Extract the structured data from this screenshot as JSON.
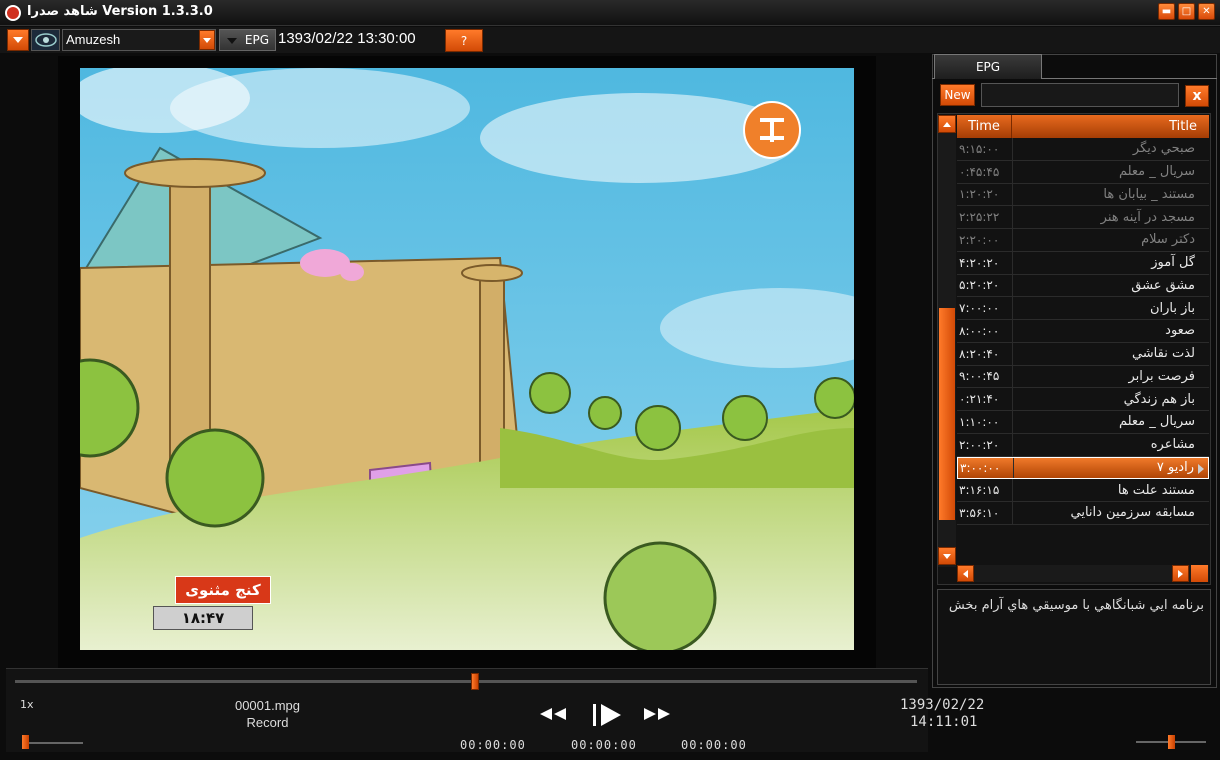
{
  "window": {
    "title": "شاهد صدرا Version 1.3.3.0"
  },
  "toolbar": {
    "channel": "Amuzesh",
    "epg_button": "EPG",
    "datetime": "1393/02/22 13:30:00",
    "help_label": "?"
  },
  "video": {
    "overlay_title": "کنج مثنوی",
    "overlay_clock": "۱۸:۴۷"
  },
  "epg": {
    "tab_label": "EPG",
    "new_label": "New",
    "search_value": "",
    "close_label": "x",
    "columns": {
      "time": "Time",
      "title": "Title"
    },
    "rows": [
      {
        "time": "۹:۱۵:۰۰",
        "title": "صبحي ديگر",
        "state": "past"
      },
      {
        "time": "۰:۴۵:۴۵",
        "title": "سريال _ معلم",
        "state": "past"
      },
      {
        "time": "۱:۲۰:۲۰",
        "title": "مستند _ بيابان ها",
        "state": "past"
      },
      {
        "time": "۲:۲۵:۲۲",
        "title": "مسجد در آينه هنر",
        "state": "past"
      },
      {
        "time": "۲:۲۰:۰۰",
        "title": "دكتر سلام",
        "state": "past"
      },
      {
        "time": "۴:۲۰:۲۰",
        "title": "گل آموز",
        "state": "future"
      },
      {
        "time": "۵:۲۰:۲۰",
        "title": "مشق عشق",
        "state": "future"
      },
      {
        "time": "۷:۰۰:۰۰",
        "title": "باز باران",
        "state": "future"
      },
      {
        "time": "۸:۰۰:۰۰",
        "title": "صعود",
        "state": "future"
      },
      {
        "time": "۸:۲۰:۴۰",
        "title": "لذت نقاشي",
        "state": "future"
      },
      {
        "time": "۹:۰۰:۴۵",
        "title": "فرصت برابر",
        "state": "future"
      },
      {
        "time": "۰:۲۱:۴۰",
        "title": "باز هم زندگي",
        "state": "future"
      },
      {
        "time": "۱:۱۰:۰۰",
        "title": "سريال _ معلم",
        "state": "future"
      },
      {
        "time": "۲:۰۰:۲۰",
        "title": "مشاعره",
        "state": "future"
      },
      {
        "time": "۳:۰۰:۰۰",
        "title": "راديو ۷",
        "state": "sel"
      },
      {
        "time": "۳:۱۶:۱۵",
        "title": "مستند علت ها",
        "state": "future"
      },
      {
        "time": "۳:۵۶:۱۰",
        "title": "مسابقه سرزمين دانايي",
        "state": "future"
      }
    ],
    "description": "برنامه ايي شبانگاهي با موسيقي هاي آرام بخش"
  },
  "controls": {
    "speed": "1x",
    "filename": "00001.mpg",
    "record": "Record",
    "timecodes": [
      "00:00:00",
      "00:00:00",
      "00:00:00"
    ],
    "clock_date": "1393/02/22",
    "clock_time": "14:11:01",
    "seek_fraction": 0.51,
    "speed_fraction": 0.05,
    "volume_fraction": 0.5
  },
  "colors": {
    "accent": "#e8621a"
  }
}
